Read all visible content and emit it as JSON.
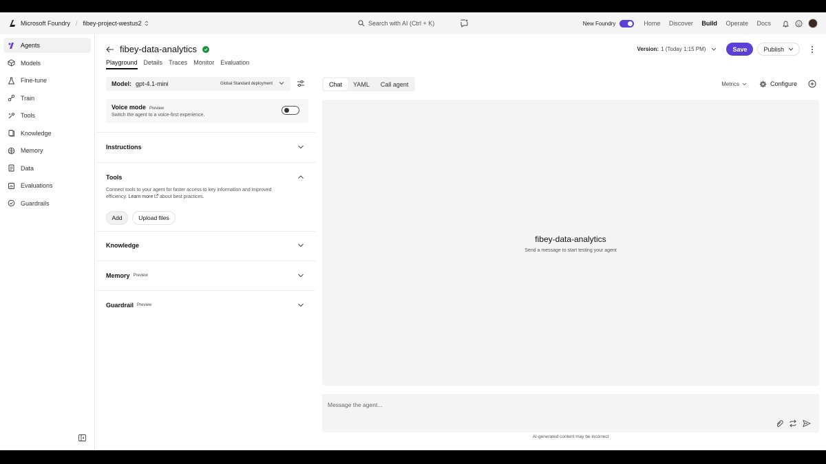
{
  "topbar": {
    "brand": "Microsoft Foundry",
    "separator": "/",
    "project": "fibey-project-westus2",
    "search_placeholder": "Search with AI (Ctrl + K)",
    "new_foundry_label": "New Foundry",
    "nav": [
      "Home",
      "Discover",
      "Build",
      "Operate",
      "Docs"
    ],
    "active_nav": "Build"
  },
  "sidebar": {
    "items": [
      {
        "label": "Agents",
        "icon": "agents-icon"
      },
      {
        "label": "Models",
        "icon": "models-icon"
      },
      {
        "label": "Fine-tune",
        "icon": "flask-icon"
      },
      {
        "label": "Train",
        "icon": "train-icon"
      },
      {
        "label": "Tools",
        "icon": "tools-icon"
      },
      {
        "label": "Knowledge",
        "icon": "knowledge-icon"
      },
      {
        "label": "Memory",
        "icon": "memory-icon"
      },
      {
        "label": "Data",
        "icon": "data-icon"
      },
      {
        "label": "Evaluations",
        "icon": "evaluations-icon"
      },
      {
        "label": "Guardrails",
        "icon": "guardrails-icon"
      }
    ],
    "active": "Agents"
  },
  "header": {
    "agent_name": "fibey-data-analytics",
    "tabs": [
      "Playground",
      "Details",
      "Traces",
      "Monitor",
      "Evaluation"
    ],
    "active_tab": "Playground",
    "version_label": "Version:",
    "version_value": "1 (Today 1:15 PM)",
    "save_label": "Save",
    "publish_label": "Publish"
  },
  "config": {
    "model_label": "Model:",
    "model_value": "gpt-4.1-mini",
    "deployment": "Global Standard deployment",
    "voice_title": "Voice mode",
    "voice_badge": "Preview",
    "voice_sub": "Switch the agent to a voice-first experience.",
    "voice_enabled": false,
    "instructions": "Instructions",
    "tools": "Tools",
    "tools_desc_1": "Connect tools to your agent for faster access to key information and improved",
    "tools_desc_2": "efficiency.",
    "tools_link": "Learn more",
    "tools_desc_3": "about best practices.",
    "add_label": "Add",
    "upload_label": "Upload files",
    "knowledge": "Knowledge",
    "memory": "Memory",
    "memory_badge": "Preview",
    "guardrail": "Guardrail",
    "guardrail_badge": "Preview"
  },
  "chat": {
    "tabs": [
      "Chat",
      "YAML",
      "Call agent"
    ],
    "active_tab": "Chat",
    "metrics_label": "Metrics",
    "configure_label": "Configure",
    "agent_name": "fibey-data-analytics",
    "hint": "Send a message to start testing your agent",
    "composer_placeholder": "Message the agent...",
    "disclaimer": "AI-generated content may be incorrect"
  },
  "colors": {
    "accent": "#5b3fd6",
    "success": "#1e8e3e",
    "panel": "#f4f4f4"
  }
}
